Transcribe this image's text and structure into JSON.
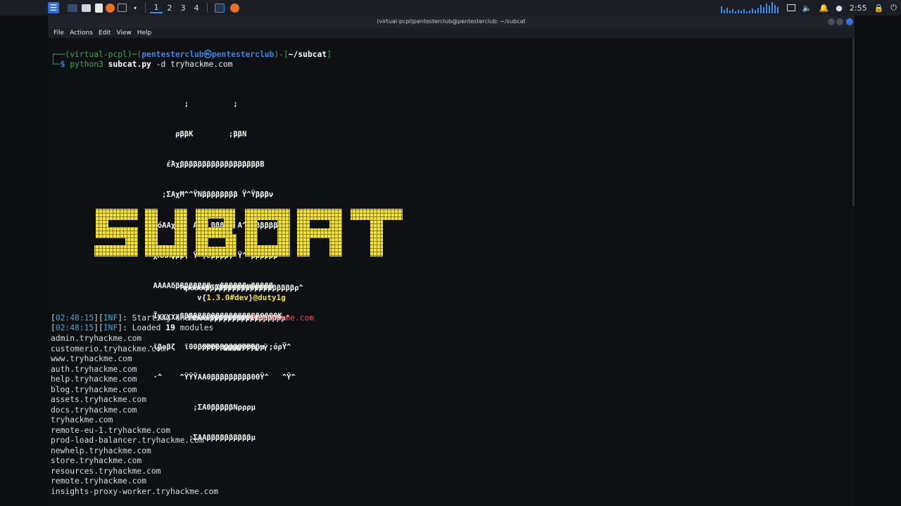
{
  "taskbar": {
    "workspaces": [
      "1",
      "2",
      "3",
      "4"
    ],
    "clock": "2:55",
    "icons": [
      "kali-menu-icon",
      "desktop-icon",
      "files-icon",
      "text-editor-icon",
      "firefox-icon",
      "terminal-icon",
      "firefox-icon"
    ]
  },
  "window": {
    "title": "(virtual-pcpl)pentesterclub@pentesterclub: ~/subcat",
    "menu": [
      "File",
      "Actions",
      "Edit",
      "View",
      "Help"
    ]
  },
  "prompt": {
    "line1_a": "┌──(virtual-pcpl)─(",
    "user_host": "pentesterclub㉿pentesterclub",
    "line1_b": ")-[",
    "path": "~/subcat",
    "line1_c": "]",
    "line2_a": "└─",
    "dollar": "$ ",
    "cmd": "python3",
    "script": "subcat.py",
    "args": " -d tryhackme.com"
  },
  "banner": {
    "art": [
      "                  ;          ;",
      "                ρββK        ;ββN",
      "              έΆχββββββββββββββββββB",
      "             ;ΣΑχΜ^^ΫΝββββββββ Ϋ^Ϋβββν",
      "            όΑΑχβ   Α   βββ^  Α^  βββββ",
      "           χΑΑΑφββ; Ϋ^;εββββ; Ϋ^ ρβββββ",
      "           ΑΑΑΑδββββββββ;χββββββμβββββ",
      "           Ϊχχχχχββββββββββββββββββ0000Κ",
      "          ·ϊβοβζ  ϊ00ββββββββββββββμ ;όρΫ^",
      "           ·^    ^ΫΫΫΑΑ0βββββββββ0ΘΫ^   ^Ϋ^",
      "                    ;ΣΑ0βββββΝρρρμ",
      "                   ;ΣΑΑββββββββββμ"
    ],
    "word": "SUBCAT",
    "art_bottom": [
      "            ^qΑΑΑΑββββββββββββββββββββρ^",
      "              Ϋ0ΑΑΑββββββββββββββββρ^",
      "                 ^ΫΫΫ^ΝΝΝΝΫΫΫL^Ϋ"
    ],
    "version_prefix": "v{",
    "version": "1.3.0",
    "tag": "#dev",
    "version_suffix": "}",
    "author": "@duty1g"
  },
  "log": [
    {
      "time": "02:48:15",
      "level": "INF",
      "msg": ": Starting enumeration for ",
      "target": "tryhackme.com"
    },
    {
      "time": "02:48:15",
      "level": "INF",
      "msg": ": Loaded ",
      "count": "19",
      "msg2": " modules"
    }
  ],
  "subdomains": [
    "admin.tryhackme.com",
    "customerio.tryhackme.com",
    "www.tryhackme.com",
    "auth.tryhackme.com",
    "help.tryhackme.com",
    "blog.tryhackme.com",
    "assets.tryhackme.com",
    "docs.tryhackme.com",
    "tryhackme.com",
    "remote-eu-1.tryhackme.com",
    "prod-load-balancer.tryhackme.com",
    "newhelp.tryhackme.com",
    "store.tryhackme.com",
    "resources.tryhackme.com",
    "remote.tryhackme.com",
    "insights-proxy-worker.tryhackme.com"
  ],
  "colors": {
    "banner_yellow": "#f2e23a",
    "prompt_blue": "#3a86e0",
    "log_blue": "#3fa7d6",
    "target_red": "#e05050"
  }
}
